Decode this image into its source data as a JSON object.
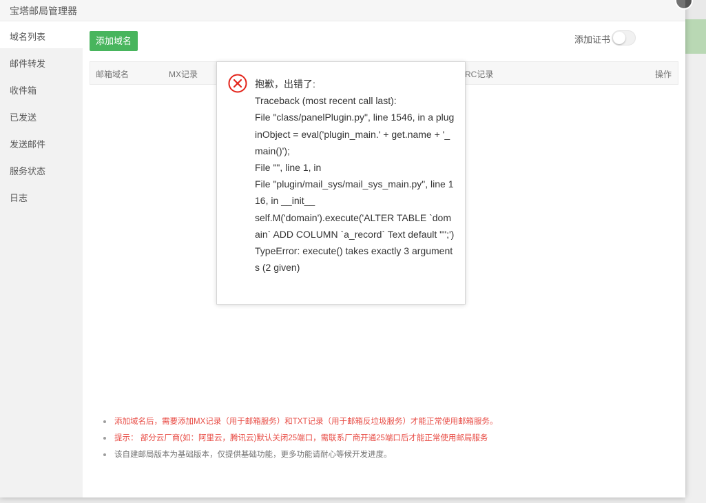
{
  "window": {
    "title": "宝塔邮局管理器"
  },
  "sidebar": {
    "items": [
      {
        "label": "域名列表",
        "active": true
      },
      {
        "label": "邮件转发"
      },
      {
        "label": "收件箱"
      },
      {
        "label": "已发送"
      },
      {
        "label": "发送邮件"
      },
      {
        "label": "服务状态"
      },
      {
        "label": "日志"
      }
    ]
  },
  "toolbar": {
    "add_domain_label": "添加域名",
    "add_cert_label": "添加证书",
    "add_cert_enabled": false
  },
  "table": {
    "headers": [
      "邮箱域名",
      "MX记录",
      "RC记录",
      "操作"
    ]
  },
  "tips": [
    {
      "text": "添加域名后，需要添加MX记录（用于邮箱服务）和TXT记录（用于邮箱反垃圾服务）才能正常使用邮箱服务。",
      "color": "#e3241b"
    },
    {
      "text": "提示：  部分云厂商(如：阿里云，腾讯云)默认关闭25端口，需联系厂商开通25端口后才能正常使用邮局服务",
      "color": "#e3241b"
    },
    {
      "text": "该自建邮局版本为基础版本，仅提供基础功能，更多功能请耐心等候开发进度。",
      "color": "#555555"
    }
  ],
  "error": {
    "icon": "error-x-icon",
    "heading": "抱歉，出错了:",
    "lines": [
      "Traceback (most recent call last):",
      "File \"class/panelPlugin.py\", line 1546, in a pluginObject = eval('plugin_main.' + get.name + '_main()');",
      "File \"\", line 1, in",
      "File \"plugin/mail_sys/mail_sys_main.py\", line 116, in __init__",
      "self.M('domain').execute('ALTER TABLE `domain` ADD COLUMN `a_record` Text default \"\";')",
      "TypeError: execute() takes exactly 3 arguments (2 given)"
    ]
  },
  "colors": {
    "accent": "#20a53a",
    "error": "#e3241b"
  }
}
